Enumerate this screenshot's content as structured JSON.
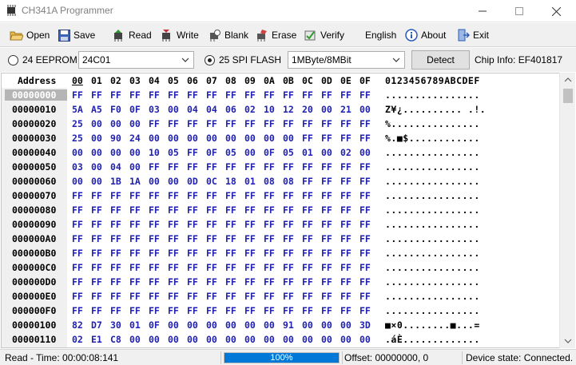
{
  "window": {
    "title": "CH341A Programmer",
    "icon": "chip-icon"
  },
  "toolbar": {
    "open": "Open",
    "save": "Save",
    "read": "Read",
    "write": "Write",
    "blank": "Blank",
    "erase": "Erase",
    "verify": "Verify",
    "language": "English",
    "about": "About",
    "exit": "Exit"
  },
  "chipbar": {
    "eeprom_label": "24 EEPROM",
    "eeprom_selected": false,
    "eeprom_model": "24C01",
    "spi_label": "25 SPI FLASH",
    "spi_selected": true,
    "spi_size": "1MByte/8MBit",
    "detect_label": "Detect",
    "chip_info": "Chip Info: EF401817"
  },
  "hex": {
    "address_header": "Address",
    "column_headers": [
      "00",
      "01",
      "02",
      "03",
      "04",
      "05",
      "06",
      "07",
      "08",
      "09",
      "0A",
      "0B",
      "0C",
      "0D",
      "0E",
      "0F"
    ],
    "ascii_header": "0123456789ABCDEF",
    "rows": [
      {
        "addr": "00000000",
        "bytes": [
          "FF",
          "FF",
          "FF",
          "FF",
          "FF",
          "FF",
          "FF",
          "FF",
          "FF",
          "FF",
          "FF",
          "FF",
          "FF",
          "FF",
          "FF",
          "FF"
        ],
        "ascii": "................"
      },
      {
        "addr": "00000010",
        "bytes": [
          "5A",
          "A5",
          "F0",
          "0F",
          "03",
          "00",
          "04",
          "04",
          "06",
          "02",
          "10",
          "12",
          "20",
          "00",
          "21",
          "00"
        ],
        "ascii": "Z¥¿.......... .!."
      },
      {
        "addr": "00000020",
        "bytes": [
          "25",
          "00",
          "00",
          "00",
          "FF",
          "FF",
          "FF",
          "FF",
          "FF",
          "FF",
          "FF",
          "FF",
          "FF",
          "FF",
          "FF",
          "FF"
        ],
        "ascii": "%..............."
      },
      {
        "addr": "00000030",
        "bytes": [
          "25",
          "00",
          "90",
          "24",
          "00",
          "00",
          "00",
          "00",
          "00",
          "00",
          "00",
          "00",
          "FF",
          "FF",
          "FF",
          "FF"
        ],
        "ascii": "%.■$............"
      },
      {
        "addr": "00000040",
        "bytes": [
          "00",
          "00",
          "00",
          "00",
          "10",
          "05",
          "FF",
          "0F",
          "05",
          "00",
          "0F",
          "05",
          "01",
          "00",
          "02",
          "00"
        ],
        "ascii": "................"
      },
      {
        "addr": "00000050",
        "bytes": [
          "03",
          "00",
          "04",
          "00",
          "FF",
          "FF",
          "FF",
          "FF",
          "FF",
          "FF",
          "FF",
          "FF",
          "FF",
          "FF",
          "FF",
          "FF"
        ],
        "ascii": "................"
      },
      {
        "addr": "00000060",
        "bytes": [
          "00",
          "00",
          "1B",
          "1A",
          "00",
          "00",
          "0D",
          "0C",
          "18",
          "01",
          "08",
          "08",
          "FF",
          "FF",
          "FF",
          "FF"
        ],
        "ascii": "................"
      },
      {
        "addr": "00000070",
        "bytes": [
          "FF",
          "FF",
          "FF",
          "FF",
          "FF",
          "FF",
          "FF",
          "FF",
          "FF",
          "FF",
          "FF",
          "FF",
          "FF",
          "FF",
          "FF",
          "FF"
        ],
        "ascii": "................"
      },
      {
        "addr": "00000080",
        "bytes": [
          "FF",
          "FF",
          "FF",
          "FF",
          "FF",
          "FF",
          "FF",
          "FF",
          "FF",
          "FF",
          "FF",
          "FF",
          "FF",
          "FF",
          "FF",
          "FF"
        ],
        "ascii": "................"
      },
      {
        "addr": "00000090",
        "bytes": [
          "FF",
          "FF",
          "FF",
          "FF",
          "FF",
          "FF",
          "FF",
          "FF",
          "FF",
          "FF",
          "FF",
          "FF",
          "FF",
          "FF",
          "FF",
          "FF"
        ],
        "ascii": "................"
      },
      {
        "addr": "000000A0",
        "bytes": [
          "FF",
          "FF",
          "FF",
          "FF",
          "FF",
          "FF",
          "FF",
          "FF",
          "FF",
          "FF",
          "FF",
          "FF",
          "FF",
          "FF",
          "FF",
          "FF"
        ],
        "ascii": "................"
      },
      {
        "addr": "000000B0",
        "bytes": [
          "FF",
          "FF",
          "FF",
          "FF",
          "FF",
          "FF",
          "FF",
          "FF",
          "FF",
          "FF",
          "FF",
          "FF",
          "FF",
          "FF",
          "FF",
          "FF"
        ],
        "ascii": "................"
      },
      {
        "addr": "000000C0",
        "bytes": [
          "FF",
          "FF",
          "FF",
          "FF",
          "FF",
          "FF",
          "FF",
          "FF",
          "FF",
          "FF",
          "FF",
          "FF",
          "FF",
          "FF",
          "FF",
          "FF"
        ],
        "ascii": "................"
      },
      {
        "addr": "000000D0",
        "bytes": [
          "FF",
          "FF",
          "FF",
          "FF",
          "FF",
          "FF",
          "FF",
          "FF",
          "FF",
          "FF",
          "FF",
          "FF",
          "FF",
          "FF",
          "FF",
          "FF"
        ],
        "ascii": "................"
      },
      {
        "addr": "000000E0",
        "bytes": [
          "FF",
          "FF",
          "FF",
          "FF",
          "FF",
          "FF",
          "FF",
          "FF",
          "FF",
          "FF",
          "FF",
          "FF",
          "FF",
          "FF",
          "FF",
          "FF"
        ],
        "ascii": "................"
      },
      {
        "addr": "000000F0",
        "bytes": [
          "FF",
          "FF",
          "FF",
          "FF",
          "FF",
          "FF",
          "FF",
          "FF",
          "FF",
          "FF",
          "FF",
          "FF",
          "FF",
          "FF",
          "FF",
          "FF"
        ],
        "ascii": "................"
      },
      {
        "addr": "00000100",
        "bytes": [
          "82",
          "D7",
          "30",
          "01",
          "0F",
          "00",
          "00",
          "00",
          "00",
          "00",
          "00",
          "91",
          "00",
          "00",
          "00",
          "3D"
        ],
        "ascii": "■×0........■...="
      },
      {
        "addr": "00000110",
        "bytes": [
          "02",
          "E1",
          "C8",
          "00",
          "00",
          "00",
          "00",
          "00",
          "00",
          "00",
          "00",
          "00",
          "00",
          "00",
          "00",
          "00"
        ],
        "ascii": ".áÈ............."
      }
    ]
  },
  "status": {
    "time": "Read - Time: 00:00:08:141",
    "progress_label": "100%",
    "progress_fraction": 1.0,
    "offset": "Offset: 00000000, 0",
    "device": "Device state: Connected."
  },
  "colors": {
    "hex_bytes": "#1f1fb0",
    "progress": "#0078d7",
    "selected_row": "#b5b5b5"
  }
}
